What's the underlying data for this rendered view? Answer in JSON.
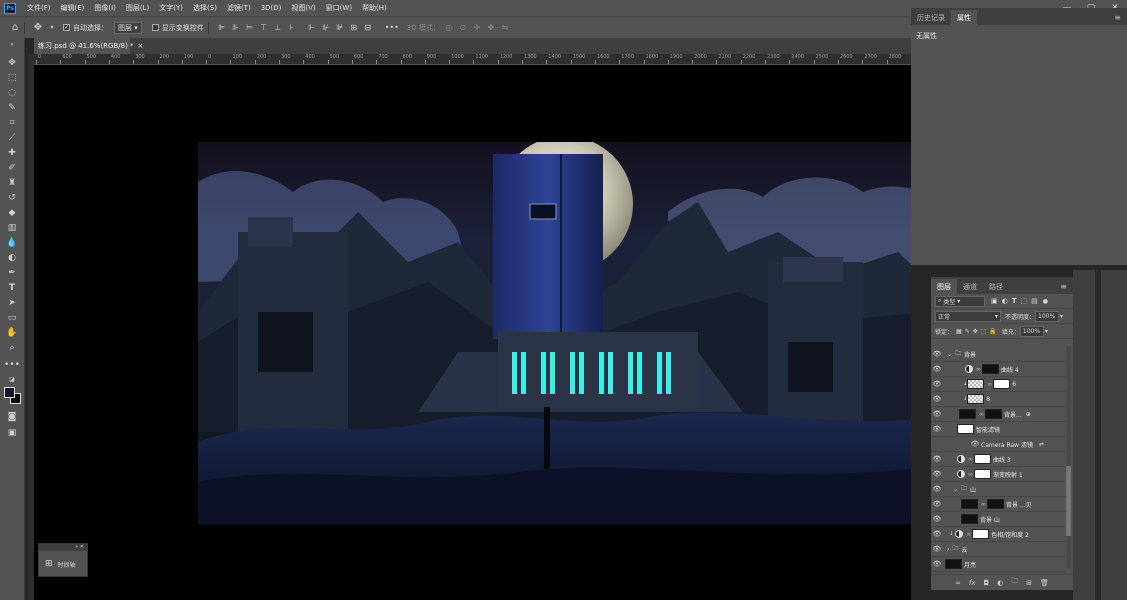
{
  "menubar": {
    "logo": "Ps",
    "items": [
      "文件(F)",
      "编辑(E)",
      "图像(I)",
      "图层(L)",
      "文字(Y)",
      "选择(S)",
      "滤镜(T)",
      "3D(D)",
      "视图(V)",
      "窗口(W)",
      "帮助(H)"
    ],
    "window_controls": [
      "—",
      "▢",
      "✕"
    ]
  },
  "options_bar": {
    "auto_select_label": "自动选择：",
    "auto_select_checked": true,
    "auto_select_target": "图层",
    "show_transform_label": "显示变换控件",
    "mode_3d_label": "3D 模式："
  },
  "document": {
    "tab_title": "练习.psd @ 41.6%(RGB/8) *",
    "close": "×"
  },
  "ruler_ticks": [
    "0",
    "600",
    "500",
    "400",
    "300",
    "200",
    "100",
    "0",
    "100",
    "200",
    "300",
    "400",
    "500",
    "600",
    "700",
    "800",
    "900",
    "1000",
    "1100",
    "1200",
    "1300",
    "1400",
    "1500",
    "1600",
    "1700",
    "1800",
    "1900",
    "2000",
    "2100",
    "2200",
    "2300",
    "2400",
    "2500",
    "2600",
    "2700",
    "2800"
  ],
  "timeline": {
    "label": "时间轴"
  },
  "history_panel": {
    "tabs": [
      "历史记录",
      "属性"
    ],
    "active_tab": "属性",
    "content": "无属性"
  },
  "layers_panel": {
    "tabs": [
      "图层",
      "通道",
      "路径"
    ],
    "active_tab": "图层",
    "filter_kind": "类型",
    "blend_mode": "正常",
    "opacity_label": "不透明度：",
    "opacity_value": "100%",
    "lock_label": "锁定：",
    "fill_label": "填充：",
    "fill_value": "100%",
    "layers": [
      {
        "name": "背景",
        "type": "group"
      },
      {
        "name": "曲线 4",
        "type": "adjust"
      },
      {
        "name": "6",
        "type": "pixel"
      },
      {
        "name": "8",
        "type": "pixel"
      },
      {
        "name": "背景...",
        "type": "smart"
      },
      {
        "name": "智能滤镜",
        "type": "filter"
      },
      {
        "name": "Camera Raw 滤镜",
        "type": "filter-item"
      },
      {
        "name": "曲线 3",
        "type": "adjust"
      },
      {
        "name": "渐变映射 1",
        "type": "adjust"
      },
      {
        "name": "山",
        "type": "group"
      },
      {
        "name": "背景 ...贝",
        "type": "pixel"
      },
      {
        "name": "背景 山",
        "type": "pixel"
      },
      {
        "name": "色相/饱和度 2",
        "type": "adjust"
      },
      {
        "name": "云",
        "type": "group"
      },
      {
        "name": "月亮",
        "type": "pixel"
      }
    ]
  }
}
